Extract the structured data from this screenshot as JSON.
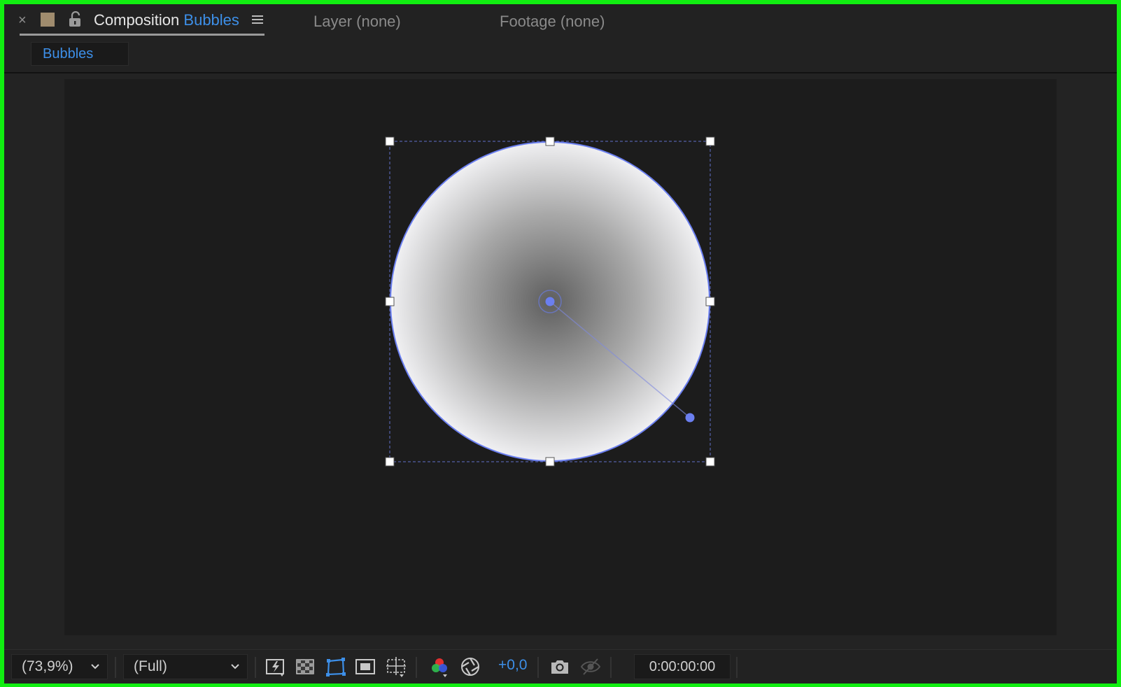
{
  "tabs": {
    "close_glyph": "×",
    "composition_prefix": "Composition",
    "composition_name": "Bubbles",
    "layer_label": "Layer (none)",
    "footage_label": "Footage (none)"
  },
  "subbar": {
    "active_comp": "Bubbles"
  },
  "toolbar": {
    "zoom": "(73,9%)",
    "resolution": "(Full)",
    "exposure": "+0,0",
    "timecode": "0:00:00:00"
  },
  "colors": {
    "accent": "#3d8fe8",
    "frame_border": "#11ee11",
    "label_swatch": "#a08c6e",
    "handle_blue": "#6b7ff0"
  },
  "icons": [
    "close-icon",
    "label-color-swatch",
    "lock-icon",
    "panel-menu-icon",
    "fast-previews-icon",
    "transparency-grid-icon",
    "mask-path-visibility-icon",
    "region-of-interest-icon",
    "grid-guides-icon",
    "channel-icon",
    "exposure-reset-icon",
    "snapshot-icon",
    "show-snapshot-icon",
    "chevron-down-icon"
  ]
}
